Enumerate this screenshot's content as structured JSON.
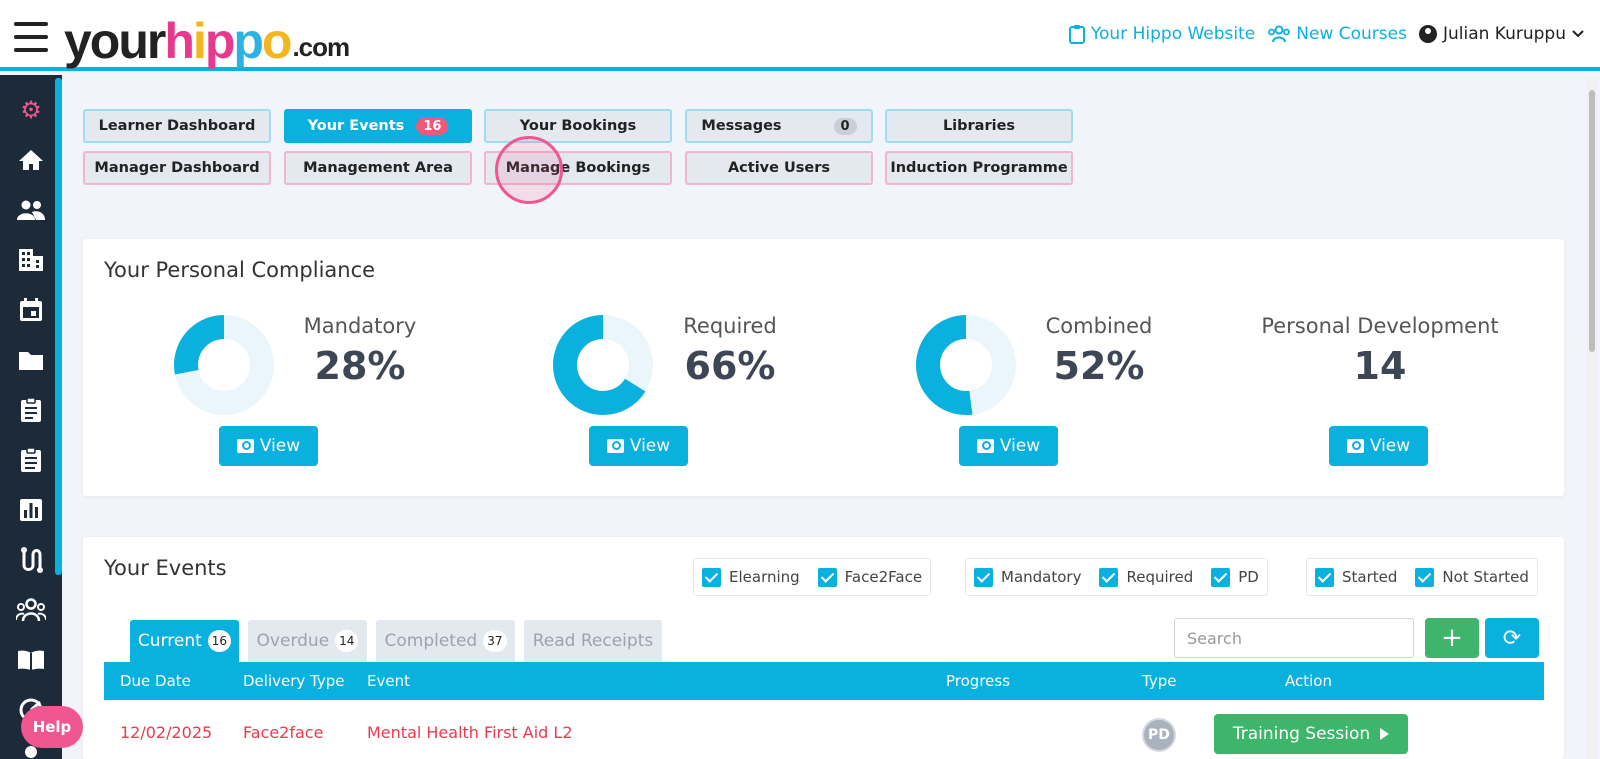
{
  "header": {
    "logo": {
      "your": "your",
      "hippo_letters": [
        "h",
        "i",
        "p",
        "p",
        "o"
      ],
      "hippo_colors": [
        "#e83a8d",
        "#f3b61f",
        "#e83a8d",
        "#2db3e3",
        "#f3b61f"
      ],
      "dotcom": ".com"
    },
    "links": {
      "website": "Your Hippo Website",
      "new_courses": "New Courses",
      "user": "Julian Kuruppu"
    }
  },
  "sidebar": {
    "icons": [
      "gear-icon",
      "home-icon",
      "users-icon",
      "building-icon",
      "calendar-icon",
      "folder-icon",
      "clipboard-icon",
      "clipboard-list-icon",
      "chart-icon",
      "route-icon",
      "group-icon",
      "book-icon",
      "chart-circle-icon",
      "user-icon"
    ]
  },
  "nav": {
    "row1": [
      {
        "label": "Learner Dashboard"
      },
      {
        "label": "Your Events",
        "badge": "16"
      },
      {
        "label": "Your Bookings"
      },
      {
        "label": "Messages",
        "badge": "0"
      },
      {
        "label": "Libraries"
      }
    ],
    "row2": [
      {
        "label": "Manager Dashboard"
      },
      {
        "label": "Management Area"
      },
      {
        "label": "Manage Bookings"
      },
      {
        "label": "Active Users"
      },
      {
        "label": "Induction Programme"
      }
    ]
  },
  "compliance": {
    "title": "Your Personal Compliance",
    "view_label": "View",
    "metrics": [
      {
        "label": "Mandatory",
        "value": "28%",
        "fraction": 0.28
      },
      {
        "label": "Required",
        "value": "66%",
        "fraction": 0.66
      },
      {
        "label": "Combined",
        "value": "52%",
        "fraction": 0.52
      },
      {
        "label": "Personal Development",
        "value": "14"
      }
    ]
  },
  "events": {
    "title": "Your Events",
    "filters": {
      "delivery": [
        "Elearning",
        "Face2Face"
      ],
      "type": [
        "Mandatory",
        "Required",
        "PD"
      ],
      "status": [
        "Started",
        "Not Started"
      ]
    },
    "tabs": [
      {
        "label": "Current",
        "count": "16"
      },
      {
        "label": "Overdue",
        "count": "14"
      },
      {
        "label": "Completed",
        "count": "37"
      },
      {
        "label": "Read Receipts"
      }
    ],
    "search_placeholder": "Search",
    "add_label": "+",
    "refresh_label": "⟳",
    "columns": [
      "Due Date",
      "Delivery Type",
      "Event",
      "Progress",
      "Type",
      "Action"
    ],
    "rows": [
      {
        "due_date": "12/02/2025",
        "delivery_type": "Face2face",
        "event": "Mental Health First Aid L2",
        "type": "PD",
        "action": "Training Session"
      }
    ]
  },
  "help_label": "Help",
  "colors": {
    "accent": "#0bb1de",
    "pink": "#f0568f",
    "green": "#3eb56b",
    "sidebar": "#1d2a3a",
    "overdue": "#e83b4f"
  }
}
